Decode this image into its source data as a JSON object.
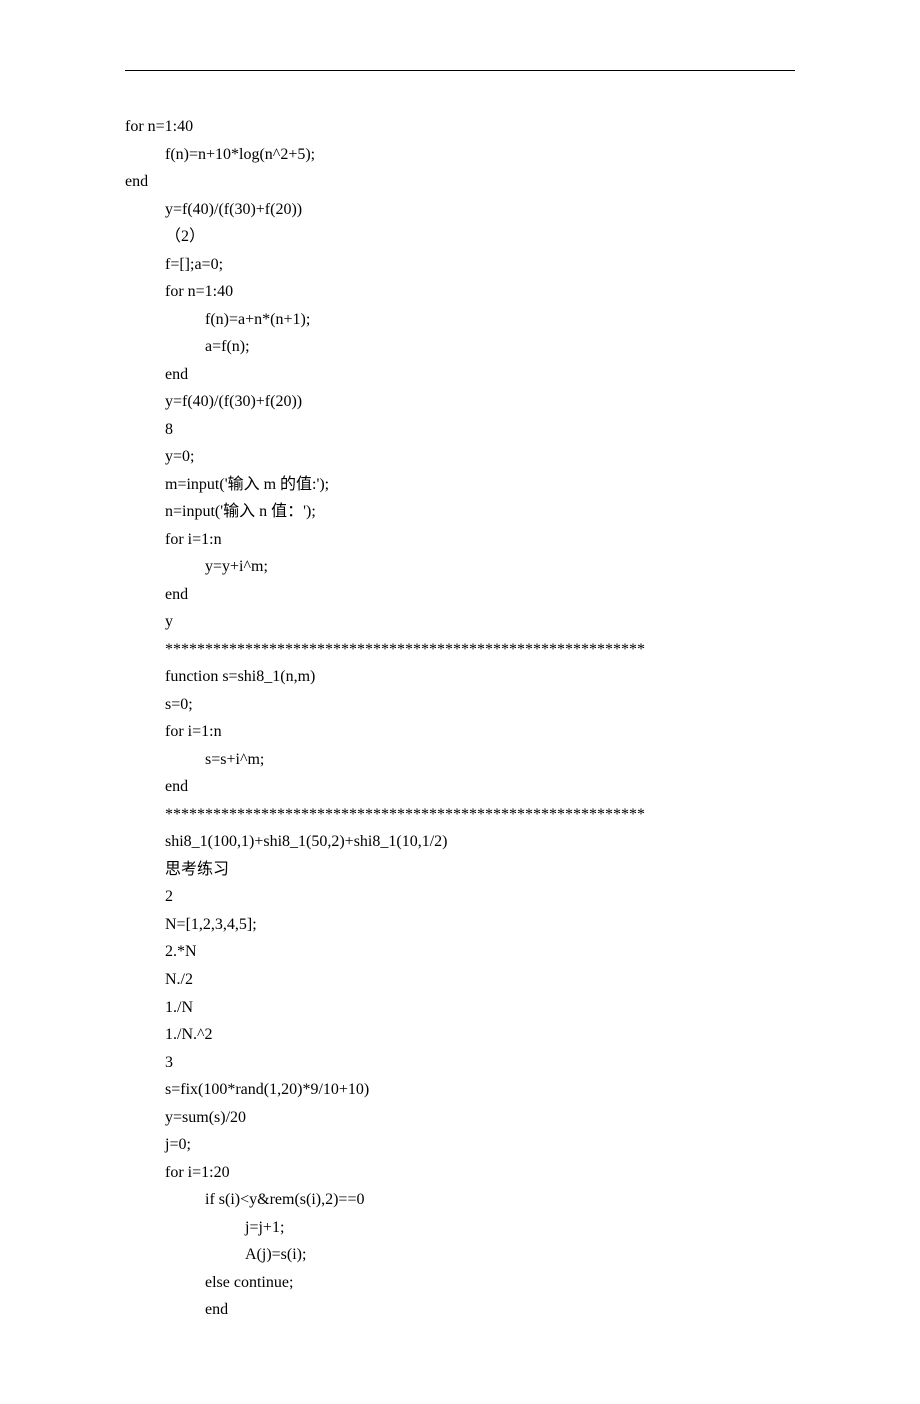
{
  "lines": [
    {
      "indent": 0,
      "text": "for n=1:40"
    },
    {
      "indent": 1,
      "text": "f(n)=n+10*log(n^2+5);"
    },
    {
      "indent": 0,
      "text": "end"
    },
    {
      "indent": 1,
      "text": "y=f(40)/(f(30)+f(20))"
    },
    {
      "indent": 1,
      "text": "（2）"
    },
    {
      "indent": 1,
      "text": "f=[];a=0;"
    },
    {
      "indent": 1,
      "text": "for n=1:40"
    },
    {
      "indent": 2,
      "text": "f(n)=a+n*(n+1);"
    },
    {
      "indent": 2,
      "text": "a=f(n);"
    },
    {
      "indent": 1,
      "text": "end"
    },
    {
      "indent": 1,
      "text": "y=f(40)/(f(30)+f(20))"
    },
    {
      "indent": 1,
      "text": "8"
    },
    {
      "indent": 1,
      "text": "y=0;"
    },
    {
      "indent": 1,
      "text": "m=input('输入 m 的值:');"
    },
    {
      "indent": 1,
      "text": "n=input('输入 n 值：');"
    },
    {
      "indent": 1,
      "text": "for i=1:n"
    },
    {
      "indent": 2,
      "text": "y=y+i^m;"
    },
    {
      "indent": 1,
      "text": "end"
    },
    {
      "indent": 1,
      "text": "y"
    },
    {
      "indent": 1,
      "text": "************************************************************"
    },
    {
      "indent": 1,
      "text": "function s=shi8_1(n,m)"
    },
    {
      "indent": 1,
      "text": "s=0;"
    },
    {
      "indent": 1,
      "text": "for i=1:n"
    },
    {
      "indent": 2,
      "text": "s=s+i^m;"
    },
    {
      "indent": 1,
      "text": "end"
    },
    {
      "indent": 1,
      "text": "************************************************************"
    },
    {
      "indent": 1,
      "text": "shi8_1(100,1)+shi8_1(50,2)+shi8_1(10,1/2)"
    },
    {
      "indent": 1,
      "text": "思考练习"
    },
    {
      "indent": 1,
      "text": "2"
    },
    {
      "indent": 1,
      "text": "N=[1,2,3,4,5];"
    },
    {
      "indent": 1,
      "text": "2.*N"
    },
    {
      "indent": 1,
      "text": "N./2"
    },
    {
      "indent": 1,
      "text": "1./N"
    },
    {
      "indent": 1,
      "text": "1./N.^2"
    },
    {
      "indent": 1,
      "text": "3"
    },
    {
      "indent": 1,
      "text": "s=fix(100*rand(1,20)*9/10+10)"
    },
    {
      "indent": 1,
      "text": "y=sum(s)/20"
    },
    {
      "indent": 1,
      "text": "j=0;"
    },
    {
      "indent": 1,
      "text": "for i=1:20"
    },
    {
      "indent": 2,
      "text": "if s(i)<y&rem(s(i),2)==0"
    },
    {
      "indent": 3,
      "text": "j=j+1;"
    },
    {
      "indent": 3,
      "text": "A(j)=s(i);"
    },
    {
      "indent": 2,
      "text": "else continue;"
    },
    {
      "indent": 2,
      "text": "end"
    }
  ]
}
